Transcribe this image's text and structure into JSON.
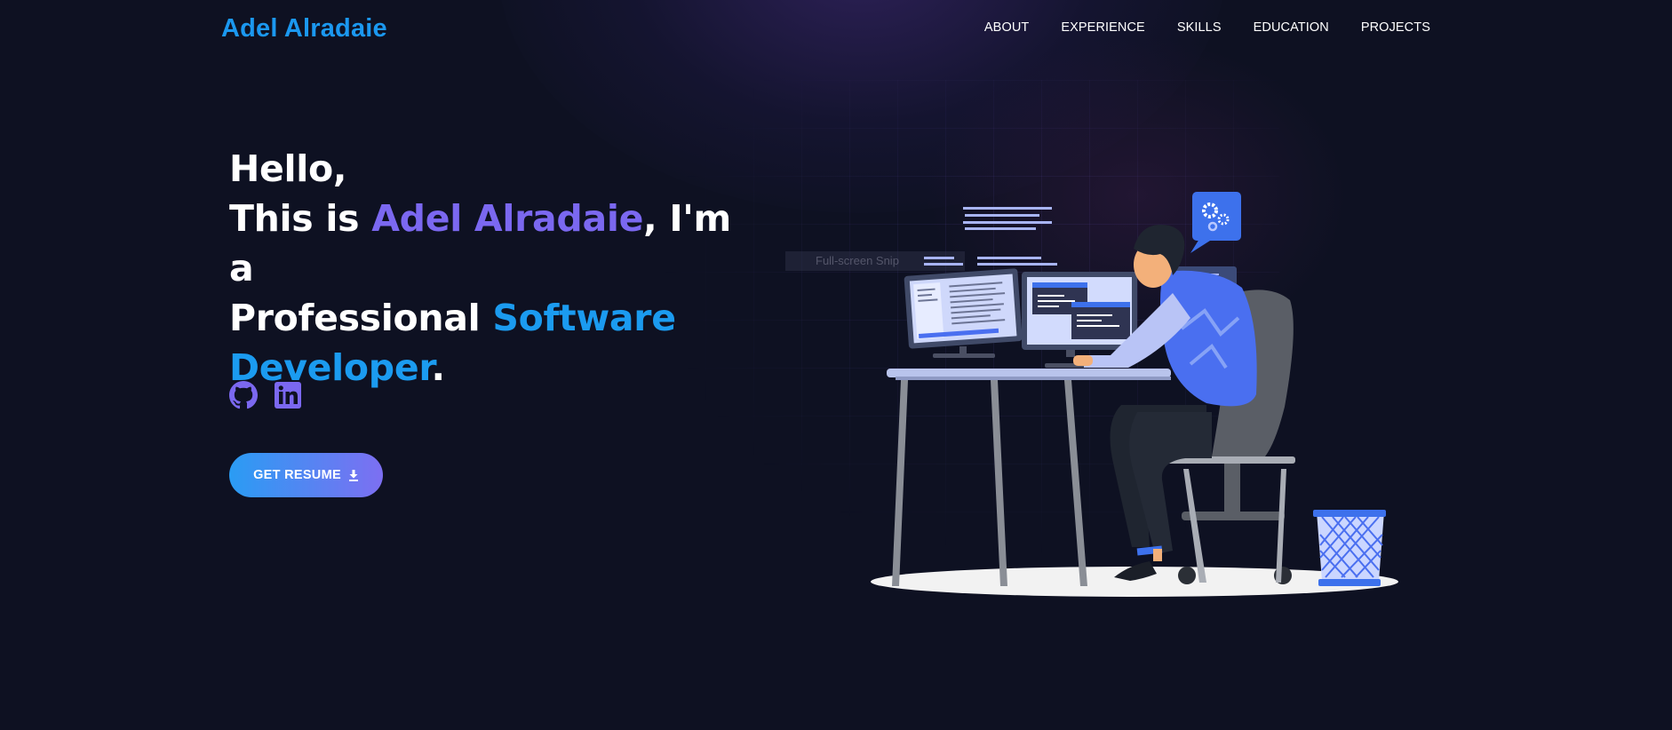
{
  "header": {
    "logo": "Adel Alradaie",
    "nav": [
      "ABOUT",
      "EXPERIENCE",
      "SKILLS",
      "EDUCATION",
      "PROJECTS"
    ]
  },
  "hero": {
    "line1": "Hello,",
    "line2_prefix": "This is ",
    "name": "Adel Alradaie",
    "line2_suffix": ", I'm a",
    "line3_prefix": "Professional ",
    "role_word1": "Software",
    "role_word2": "Developer",
    "end_punct": "."
  },
  "socials": [
    "github-icon",
    "linkedin-icon"
  ],
  "resume_button": {
    "label": "GET RESUME",
    "icon": "download-icon"
  },
  "snip_overlay": "Full-screen Snip",
  "colors": {
    "background": "#0e1122",
    "accent_blue": "#1b98f0",
    "accent_purple": "#7b68f0"
  }
}
